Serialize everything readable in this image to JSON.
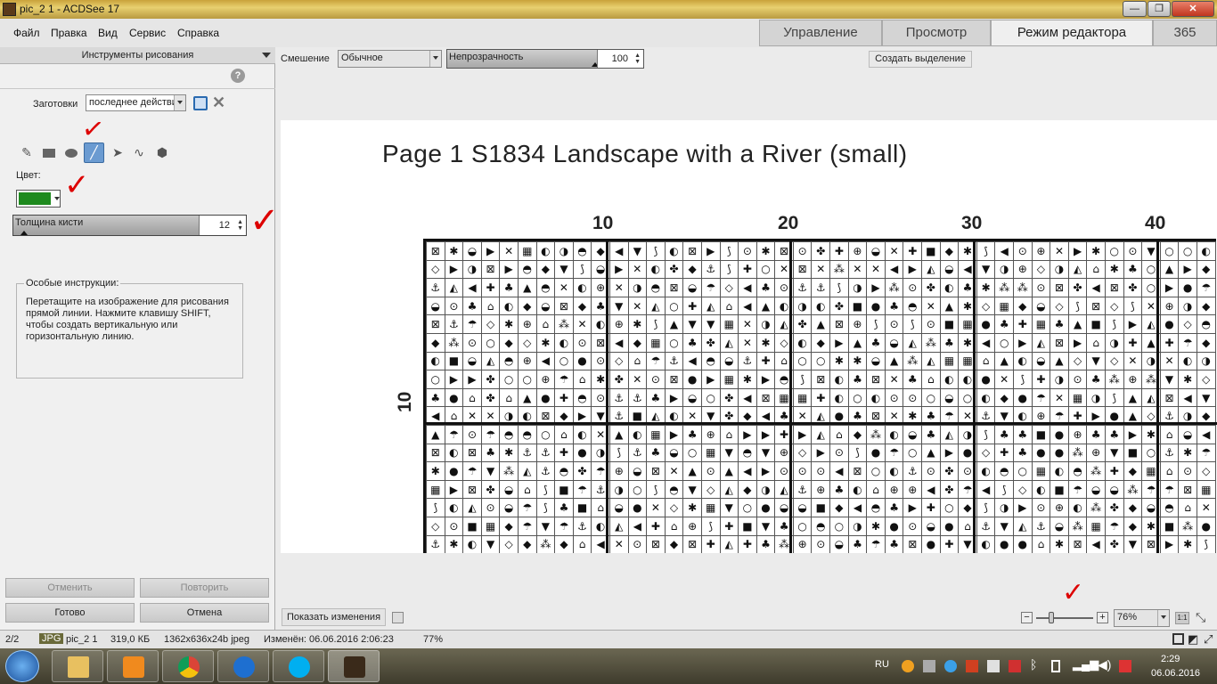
{
  "window": {
    "title": "pic_2 1 - ACDSee 17",
    "buttons": [
      "—",
      "❐",
      "✕"
    ]
  },
  "menu": [
    "Файл",
    "Правка",
    "Вид",
    "Сервис",
    "Справка"
  ],
  "mode_tabs": [
    {
      "label": "Управление",
      "active": false
    },
    {
      "label": "Просмотр",
      "active": false
    },
    {
      "label": "Режим редактора",
      "active": true
    },
    {
      "label": "365",
      "active": false
    }
  ],
  "panel": {
    "header": "Инструменты рисования",
    "presets_label": "Заготовки",
    "presets_value": "последнее действие",
    "color_label": "Цвет:",
    "color_value": "#1e8a1e",
    "brush_label": "Толщина кисти",
    "brush_value": "12",
    "instructions_title": "Особые инструкции:",
    "instructions_text": "Перетащите на изображение для рисования прямой линии. Нажмите клавишу SHIFT, чтобы создать вертикальную или горизонтальную линию.",
    "btn_undo": "Отменить",
    "btn_redo": "Повторить",
    "btn_done": "Готово",
    "btn_cancel": "Отмена",
    "tools": [
      "pencil-icon",
      "rectangle-icon",
      "ellipse-icon",
      "line-icon",
      "arrow-icon",
      "curve-icon",
      "polygon-icon"
    ]
  },
  "toolbar": {
    "blend_label": "Смешение",
    "blend_value": "Обычное",
    "opacity_label": "Непрозрачность",
    "opacity_value": "100",
    "create_selection": "Создать выделение"
  },
  "image": {
    "title": "Page 1  S1834 Landscape with a River (small)",
    "col_numbers": [
      "10",
      "20",
      "30",
      "40"
    ],
    "row_number": "10"
  },
  "bottom": {
    "show_changes": "Показать изменения",
    "zoom": "76%",
    "one_to_one": "1:1"
  },
  "status": {
    "index": "2/2",
    "format": "JPG",
    "filename": "pic_2 1",
    "size": "319,0 КБ",
    "dimensions": "1362x636x24b jpeg",
    "modified": "Изменён: 06.06.2016 2:06:23",
    "zoom": "77%"
  },
  "taskbar": {
    "lang": "RU",
    "time": "2:29",
    "date": "06.06.2016"
  }
}
